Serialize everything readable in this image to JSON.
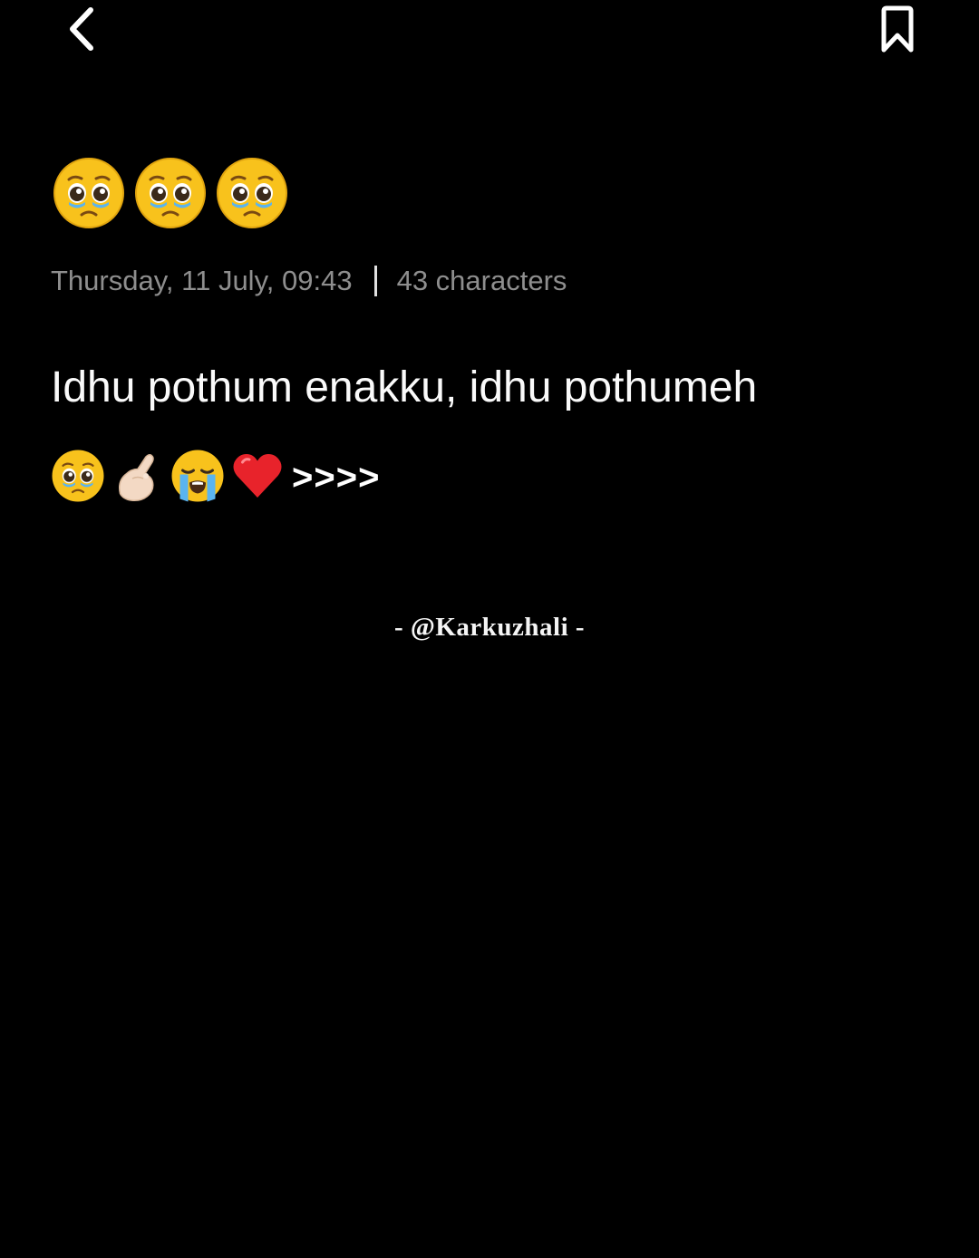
{
  "header": {
    "back_icon": "chevron-left-icon",
    "bookmark_icon": "bookmark-icon"
  },
  "note": {
    "title_emojis": [
      "pleading-face",
      "pleading-face",
      "pleading-face"
    ],
    "meta": {
      "date": "Thursday, 11 July, 09:43",
      "count": "43 characters"
    },
    "body_text": "Idhu pothum enakku, idhu pothumeh",
    "emoji_line": {
      "emojis": [
        "pleading-face",
        "pinching-hand",
        "loudly-crying-face",
        "red-heart"
      ],
      "suffix": ">>>>"
    },
    "signature": "- @Karkuzhali -"
  },
  "colors": {
    "background": "#000000",
    "meta_text": "#8e8e8e",
    "body_text": "#fafafa",
    "emoji_yellow": "#f8c21c",
    "tear_blue": "#5ab4f0",
    "heart_red": "#e8232b"
  }
}
